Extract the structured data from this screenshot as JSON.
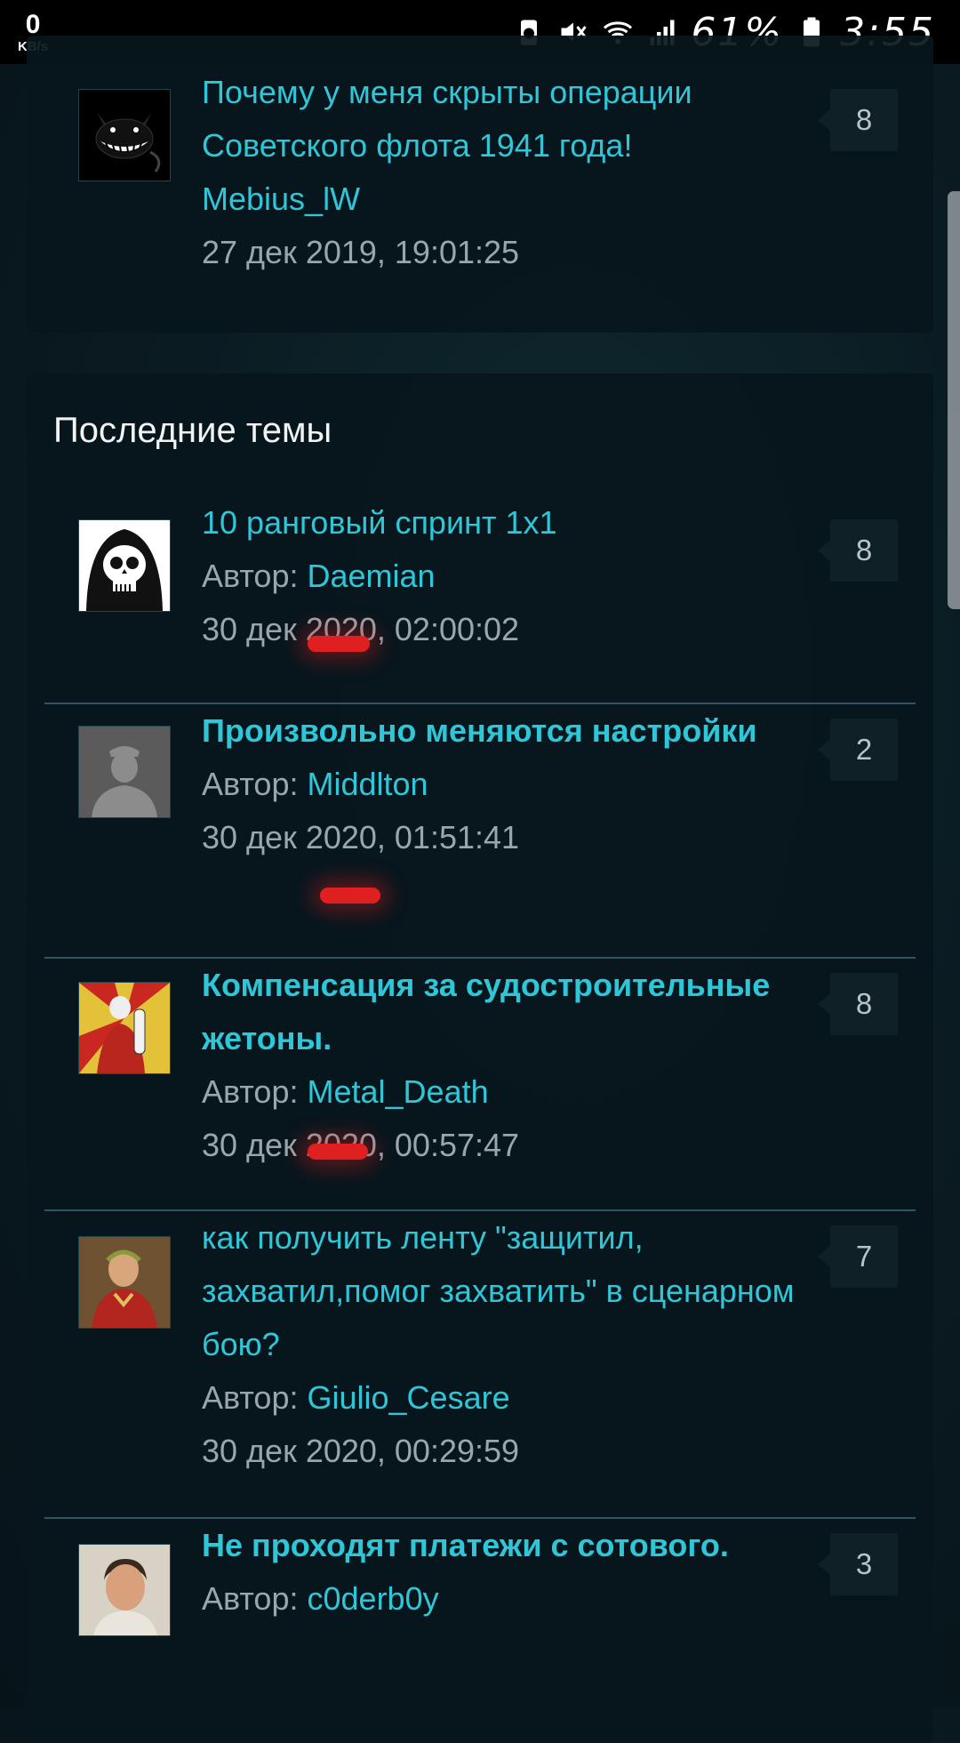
{
  "status_bar": {
    "net_speed": "0",
    "net_unit": "KB/s",
    "battery_percent": "61%",
    "time": "3:55",
    "icons": [
      "battery-saver-icon",
      "mute-icon",
      "wifi-icon",
      "signal-icon",
      "battery-icon"
    ]
  },
  "top_topic": {
    "title": "Почему у меня скрыты операции Советского флота 1941 года!",
    "author": "Mebius_lW",
    "date": "27 дек 2019, 19:01:25",
    "count": "8"
  },
  "latest": {
    "heading": "Последние темы",
    "author_label": "Автор:",
    "topics": [
      {
        "title": "10 ранговый спринт 1x1",
        "bold": false,
        "author": "Daemian",
        "date": "30 дек 2020, 02:00:02",
        "count": "8"
      },
      {
        "title": "Произвольно меняются настройки",
        "bold": true,
        "author": "Middlton",
        "date": "30 дек 2020, 01:51:41",
        "count": "2"
      },
      {
        "title": "Компенсация за судостроительные жетоны.",
        "bold": true,
        "author": "Metal_Death",
        "date": "30 дек 2020, 00:57:47",
        "count": "8"
      },
      {
        "title": "как получить ленту \"защитил, захватил,помог захватить\" в сценарном бою?",
        "bold": false,
        "author": "Giulio_Cesare",
        "date": "30 дек 2020, 00:29:59",
        "count": "7"
      },
      {
        "title": "Не проходят платежи с сотового.",
        "bold": true,
        "author": "c0derb0y",
        "date": "",
        "count": "3"
      }
    ]
  },
  "colors": {
    "accent": "#2fc6d7",
    "annotation": "#e02020"
  }
}
